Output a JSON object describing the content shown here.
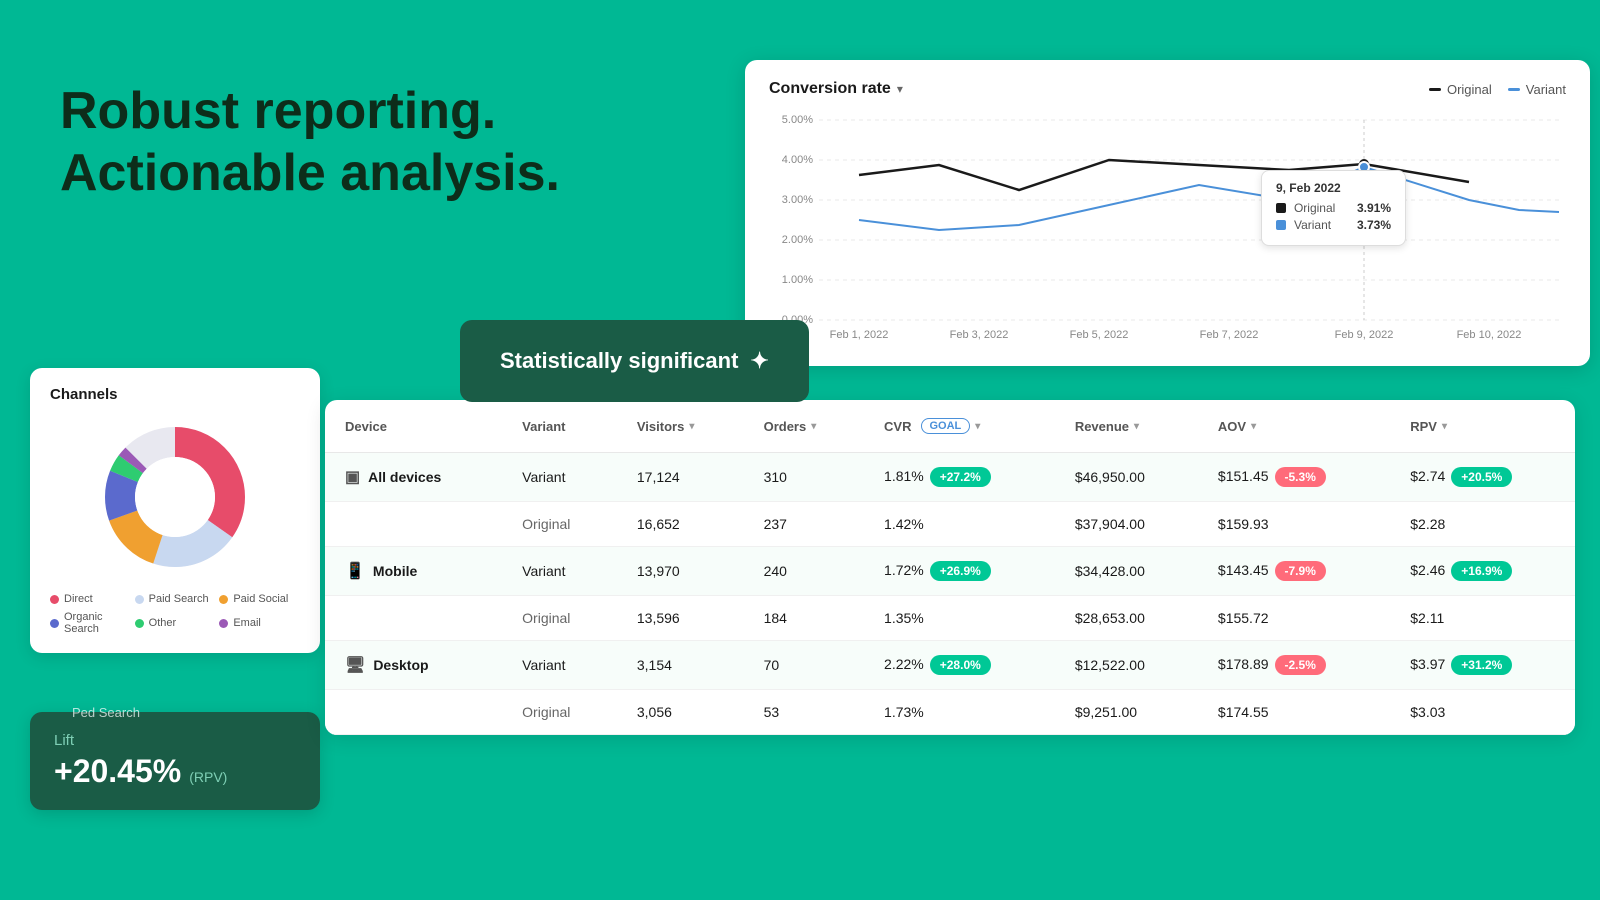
{
  "hero": {
    "line1": "Robust reporting.",
    "line2": "Actionable analysis."
  },
  "stat_sig": {
    "label": "Statistically significant",
    "icon": "✦"
  },
  "chart": {
    "title": "Conversion rate",
    "legend": {
      "original": "Original",
      "variant": "Variant"
    },
    "tooltip": {
      "date": "9, Feb 2022",
      "original_label": "Original",
      "original_value": "3.91%",
      "variant_label": "Variant",
      "variant_value": "3.73%"
    },
    "y_labels": [
      "5.00%",
      "4.00%",
      "3.00%",
      "2.00%",
      "1.00%",
      "0.00%"
    ],
    "x_labels": [
      "Feb 1, 2022",
      "Feb 3, 2022",
      "Feb 5, 2022",
      "Feb 7, 2022",
      "Feb 9, 2022",
      "Feb 10, 2022"
    ]
  },
  "channels": {
    "title": "Channels",
    "legend": [
      {
        "label": "Direct",
        "color": "#e74c6a"
      },
      {
        "label": "Paid Search",
        "color": "#c8d8f0"
      },
      {
        "label": "Paid Social",
        "color": "#f0a030"
      },
      {
        "label": "Organic Search",
        "color": "#5b6acd"
      },
      {
        "label": "Other",
        "color": "#2ecc71"
      },
      {
        "label": "Email",
        "color": "#9b59b6"
      }
    ]
  },
  "lift": {
    "label": "Lift",
    "value": "+20.45%",
    "unit": "(RPV)"
  },
  "table": {
    "columns": [
      "Device",
      "Variant",
      "Visitors",
      "Orders",
      "CVR",
      "Revenue",
      "AOV",
      "RPV"
    ],
    "rows": [
      {
        "device": "All devices",
        "device_icon": "▣",
        "variant": "Variant",
        "is_variant": true,
        "visitors": "17,124",
        "orders": "310",
        "cvr": "1.81%",
        "cvr_badge": "+27.2%",
        "cvr_badge_type": "green",
        "revenue": "$46,950.00",
        "aov": "$151.45",
        "aov_badge": "-5.3%",
        "aov_badge_type": "red",
        "rpv": "$2.74",
        "rpv_badge": "+20.5%",
        "rpv_badge_type": "green"
      },
      {
        "device": "",
        "device_icon": "",
        "variant": "Original",
        "is_variant": false,
        "visitors": "16,652",
        "orders": "237",
        "cvr": "1.42%",
        "cvr_badge": "",
        "revenue": "$37,904.00",
        "aov": "$159.93",
        "aov_badge": "",
        "rpv": "$2.28",
        "rpv_badge": ""
      },
      {
        "device": "Mobile",
        "device_icon": "📱",
        "variant": "Variant",
        "is_variant": true,
        "visitors": "13,970",
        "orders": "240",
        "cvr": "1.72%",
        "cvr_badge": "+26.9%",
        "cvr_badge_type": "green",
        "revenue": "$34,428.00",
        "aov": "$143.45",
        "aov_badge": "-7.9%",
        "aov_badge_type": "red",
        "rpv": "$2.46",
        "rpv_badge": "+16.9%",
        "rpv_badge_type": "green"
      },
      {
        "device": "",
        "device_icon": "",
        "variant": "Original",
        "is_variant": false,
        "visitors": "13,596",
        "orders": "184",
        "cvr": "1.35%",
        "cvr_badge": "",
        "revenue": "$28,653.00",
        "aov": "$155.72",
        "aov_badge": "",
        "rpv": "$2.11",
        "rpv_badge": ""
      },
      {
        "device": "Desktop",
        "device_icon": "🖥",
        "variant": "Variant",
        "is_variant": true,
        "visitors": "3,154",
        "orders": "70",
        "cvr": "2.22%",
        "cvr_badge": "+28.0%",
        "cvr_badge_type": "green",
        "revenue": "$12,522.00",
        "aov": "$178.89",
        "aov_badge": "-2.5%",
        "aov_badge_type": "red",
        "rpv": "$3.97",
        "rpv_badge": "+31.2%",
        "rpv_badge_type": "green"
      },
      {
        "device": "",
        "device_icon": "",
        "variant": "Original",
        "is_variant": false,
        "visitors": "3,056",
        "orders": "53",
        "cvr": "1.73%",
        "cvr_badge": "",
        "revenue": "$9,251.00",
        "aov": "$174.55",
        "aov_badge": "",
        "rpv": "$3.03",
        "rpv_badge": ""
      }
    ]
  },
  "ped_search": "Ped Search"
}
